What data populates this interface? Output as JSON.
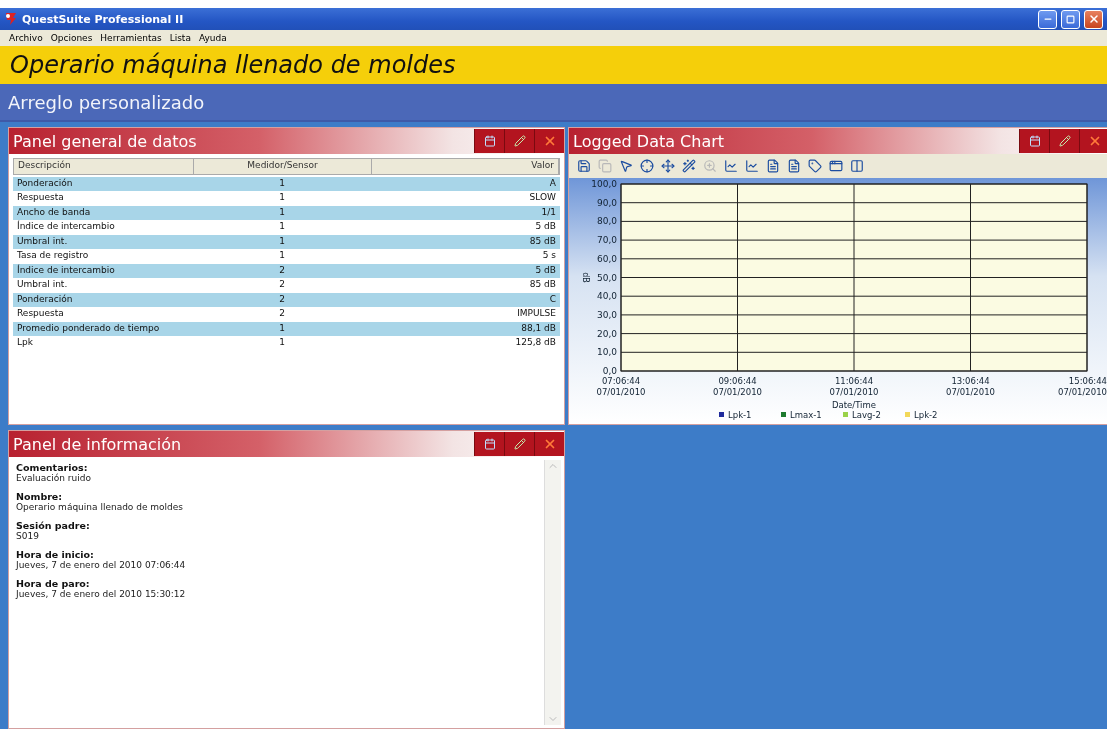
{
  "window": {
    "title": "QuestSuite Professional II"
  },
  "menu": [
    "Archivo",
    "Opciones",
    "Herramientas",
    "Lista",
    "Ayuda"
  ],
  "session_title": "Operario máquina llenado de moldes",
  "layout_title": "Arreglo personalizado",
  "data_panel": {
    "title": "Panel general de datos",
    "columns": [
      "Descripción",
      "Medidor/Sensor",
      "Valor"
    ],
    "rows": [
      {
        "description": "Ponderación",
        "meter": "1",
        "value": "A"
      },
      {
        "description": "Respuesta",
        "meter": "1",
        "value": "SLOW"
      },
      {
        "description": "Ancho de banda",
        "meter": "1",
        "value": "1/1"
      },
      {
        "description": "Índice de intercambio",
        "meter": "1",
        "value": "5 dB"
      },
      {
        "description": "Umbral int.",
        "meter": "1",
        "value": "85 dB"
      },
      {
        "description": "Tasa de registro",
        "meter": "1",
        "value": "5 s"
      },
      {
        "description": "Índice de intercambio",
        "meter": "2",
        "value": "5 dB"
      },
      {
        "description": "Umbral int.",
        "meter": "2",
        "value": "85 dB"
      },
      {
        "description": "Ponderación",
        "meter": "2",
        "value": "C"
      },
      {
        "description": "Respuesta",
        "meter": "2",
        "value": "IMPULSE"
      },
      {
        "description": "Promedio ponderado de tiempo",
        "meter": "1",
        "value": "88,1 dB"
      },
      {
        "description": "Lpk",
        "meter": "1",
        "value": "125,8 dB"
      }
    ]
  },
  "chart_panel": {
    "title": "Logged Data Chart",
    "toolbar": [
      {
        "kind": "save",
        "disabled": false
      },
      {
        "kind": "copy",
        "disabled": true
      },
      {
        "kind": "pointer",
        "disabled": false
      },
      {
        "kind": "crosshair",
        "disabled": false
      },
      {
        "kind": "move",
        "disabled": false
      },
      {
        "kind": "wand",
        "disabled": false
      },
      {
        "kind": "zoom",
        "disabled": true
      },
      {
        "kind": "chart",
        "disabled": false
      },
      {
        "kind": "chart",
        "disabled": false
      },
      {
        "kind": "page",
        "disabled": false
      },
      {
        "kind": "page",
        "disabled": false
      },
      {
        "kind": "label",
        "disabled": false
      },
      {
        "kind": "window",
        "disabled": false
      },
      {
        "kind": "columns",
        "disabled": false
      }
    ],
    "chart_data": {
      "type": "line",
      "grid": true,
      "xlabel": "Date/Time",
      "ylabel": "dB",
      "categories": [
        "07:06:44\n07/01/2010",
        "09:06:44\n07/01/2010",
        "11:06:44\n07/01/2010",
        "13:06:44\n07/01/2010",
        "15:06:44\n07/01/2010"
      ],
      "ylim": [
        0,
        100
      ],
      "yticks": [
        {
          "value": 0,
          "label": "0,0"
        },
        {
          "value": 10,
          "label": "10,0"
        },
        {
          "value": 20,
          "label": "20,0"
        },
        {
          "value": 30,
          "label": "30,0"
        },
        {
          "value": 40,
          "label": "40,0"
        },
        {
          "value": 50,
          "label": "50,0"
        },
        {
          "value": 60,
          "label": "60,0"
        },
        {
          "value": 70,
          "label": "70,0"
        },
        {
          "value": 80,
          "label": "80,0"
        },
        {
          "value": 90,
          "label": "90,0"
        },
        {
          "value": 100,
          "label": "100,0"
        }
      ],
      "series": [
        {
          "name": "Lpk-1",
          "color": "#1f2a9c",
          "values": [
            null,
            null,
            null,
            null,
            null
          ]
        },
        {
          "name": "Lmax-1",
          "color": "#1d7a2e",
          "values": [
            null,
            null,
            null,
            null,
            null
          ]
        },
        {
          "name": "Lavg-2",
          "color": "#9ad24a",
          "values": [
            null,
            null,
            null,
            null,
            null
          ]
        },
        {
          "name": "Lpk-2",
          "color": "#f2d85a",
          "values": [
            null,
            null,
            null,
            null,
            null
          ]
        }
      ]
    }
  },
  "info_panel": {
    "title": "Panel de información",
    "fields": [
      {
        "label": "Comentarios:",
        "value": "Evaluación ruido"
      },
      {
        "label": "Nombre:",
        "value": "Operario máquina llenado de moldes"
      },
      {
        "label": "Sesión padre:",
        "value": "S019"
      },
      {
        "label": "Hora de inicio:",
        "value": "Jueves, 7 de enero del 2010 07:06:44"
      },
      {
        "label": "Hora de paro:",
        "value": "Jueves, 7 de enero del 2010 15:30:12"
      }
    ]
  }
}
